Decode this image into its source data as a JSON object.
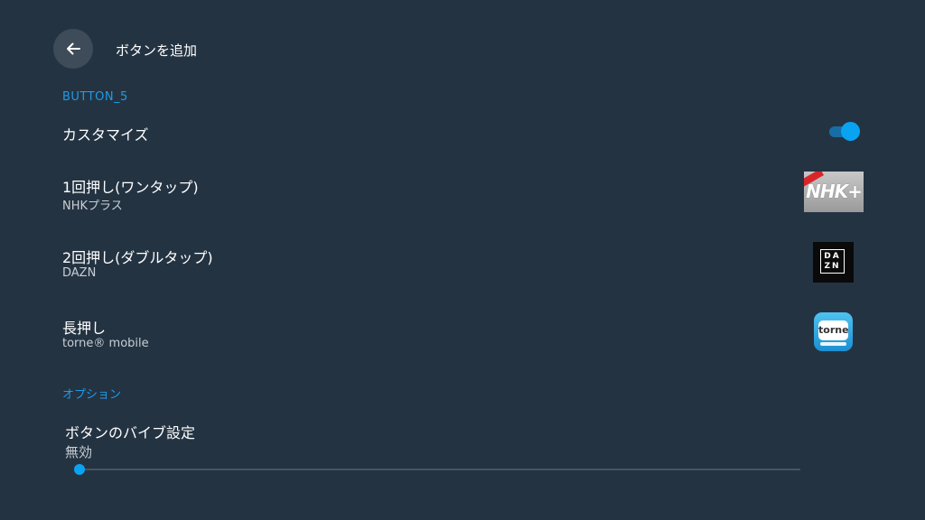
{
  "header": {
    "title": "ボタンを追加",
    "back_icon": "arrow-left-icon"
  },
  "sections": {
    "button_section_label": "BUTTON_5",
    "options_section_label": "オプション"
  },
  "customize": {
    "label": "カスタマイズ",
    "enabled": true,
    "accent_color": "#09a3f2"
  },
  "actions": [
    {
      "title": "1回押し(ワンタップ)",
      "app": "NHKプラス",
      "icon": "nhk-plus-icon"
    },
    {
      "title": "2回押し(ダブルタップ)",
      "app": "DAZN",
      "icon": "dazn-icon"
    },
    {
      "title": "長押し",
      "app": "torne® mobile",
      "icon": "torne-mobile-icon"
    }
  ],
  "icons_text": {
    "nhk_logo": "NHK+",
    "dazn_top": "DA",
    "dazn_bottom": "ZN",
    "torne": "torne"
  },
  "vibration": {
    "label": "ボタンのバイブ設定",
    "value": "無効",
    "level": 0
  },
  "colors": {
    "background": "#243342",
    "accent": "#1e9be9"
  }
}
